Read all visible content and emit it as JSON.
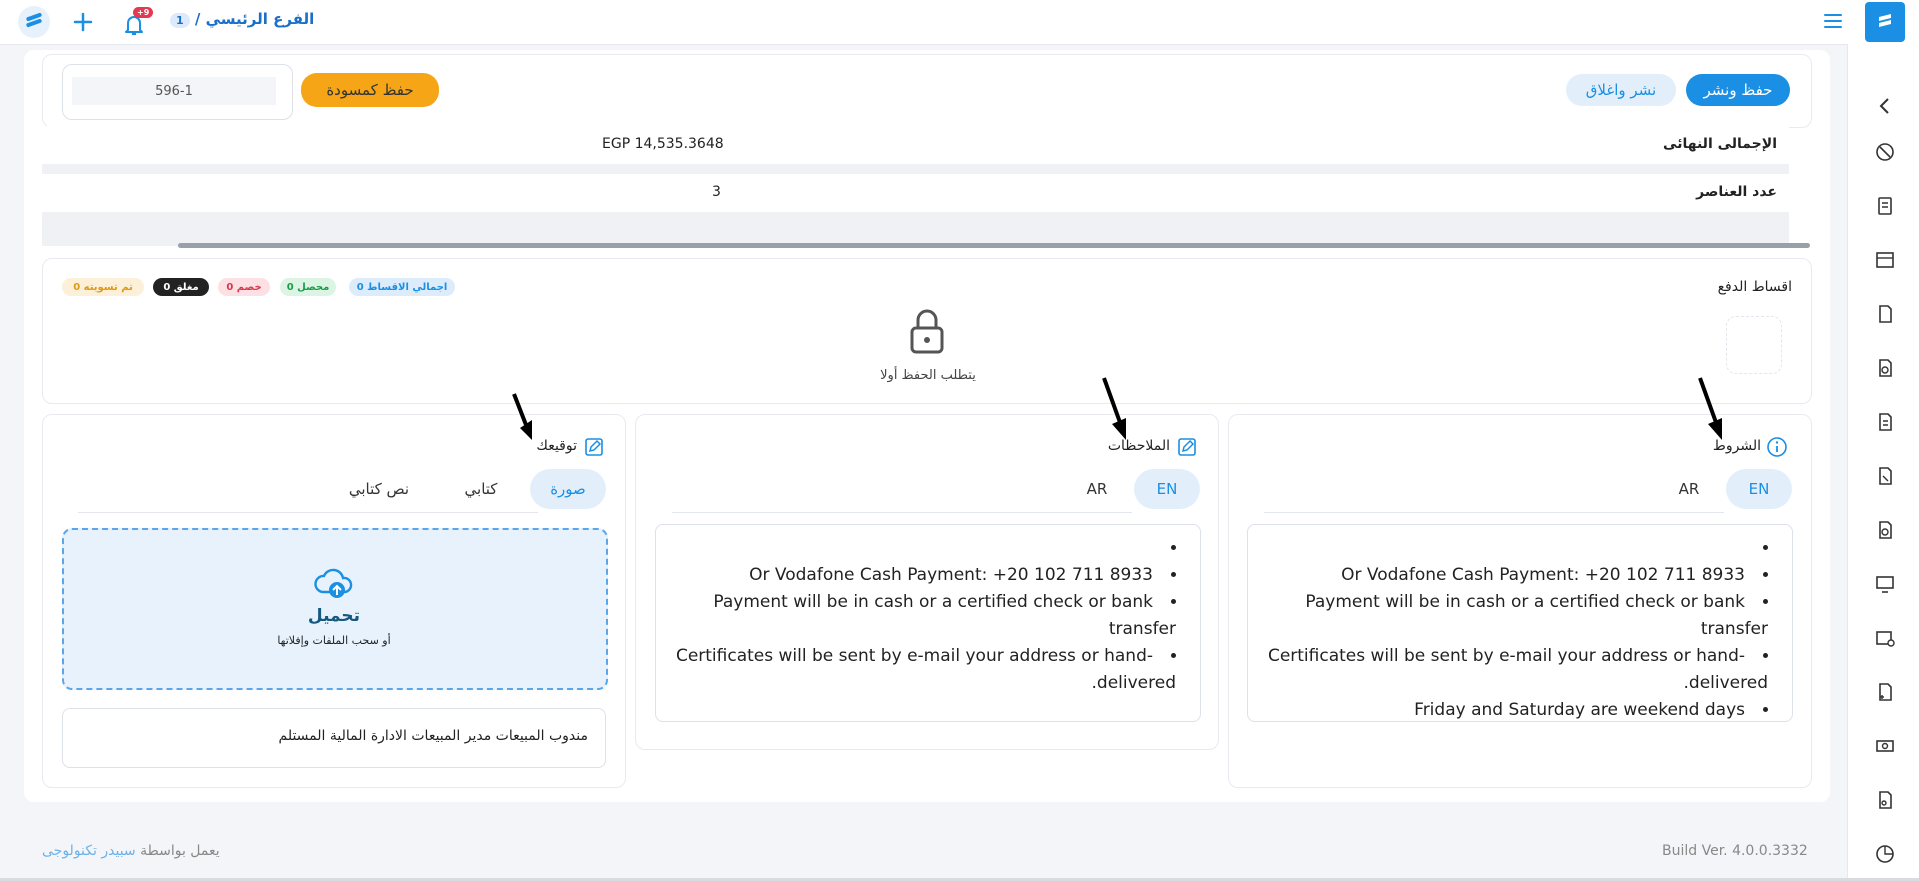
{
  "topbar": {
    "branch_name": "الفرع الرئيسي /",
    "branch_count": "1",
    "notifications_badge": "+9"
  },
  "toolbar": {
    "save_publish": "حفظ ونشر",
    "publish_close": "نشر واغلاق",
    "save_draft": "حفظ كمسودة",
    "doc_number": "596-1"
  },
  "summary": {
    "grand_total_label": "الإجمالى النهائى",
    "grand_total_value": "EGP 14,535.3648",
    "items_count_label": "عدد العناصر",
    "items_count_value": "3"
  },
  "installments": {
    "title": "اقساط الدفع",
    "pills": {
      "total": "اجمالي الاقساط 0",
      "collected": "محصل 0",
      "discount": "خصم 0",
      "closed": "مغلق 0",
      "settled": "تم تسويته 0"
    },
    "locked_message": "يتطلب الحفظ أولا"
  },
  "terms": {
    "title": "الشروط",
    "tab_en": "EN",
    "tab_ar": "AR",
    "lines": [
      "",
      "Or Vodafone Cash Payment: +20 102 711 8933",
      "Payment will be in cash or a certified check or bank transfer",
      "Certificates will be sent by e-mail your address or hand-delivered.",
      "Friday and Saturday are weekend days"
    ]
  },
  "notes": {
    "title": "الملاحظات",
    "tab_en": "EN",
    "tab_ar": "AR",
    "lines": [
      "",
      "Or Vodafone Cash Payment: +20 102 711 8933",
      "Payment will be in cash or a certified check or bank transfer",
      "Certificates will be sent by e-mail your address or hand-delivered."
    ]
  },
  "signature": {
    "title": "توقيعك",
    "tab_image": "صورة",
    "tab_written": "كتابي",
    "tab_text": "نص كتابي",
    "upload_title": "تحميل",
    "upload_hint": "أو سحب الملفات وإفلاتها",
    "signers_text": "مندوب المبيعات مدير المبيعات الادارة المالية المستلم"
  },
  "footer": {
    "powered_by": "يعمل بواسطة",
    "company": "سبيدر تكنولوجى",
    "build": "Build Ver. 4.0.0.3332"
  },
  "colors": {
    "primary": "#1a8fe3",
    "accent_orange": "#f5a516",
    "badge_red": "#e53950"
  }
}
